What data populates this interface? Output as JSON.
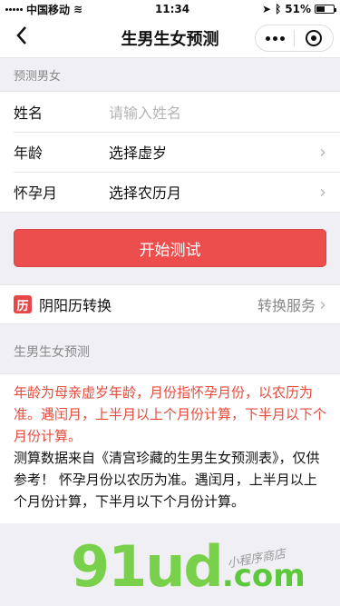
{
  "status_bar": {
    "carrier": "中国移动",
    "time": "11:34",
    "battery": "51%",
    "battery_level": 0.51
  },
  "nav": {
    "title": "生男生女预测",
    "back_icon": "chevron-left-icon",
    "more_icon": "more-dots-icon",
    "close_icon": "target-circle-icon"
  },
  "form": {
    "section_title": "预测男女",
    "rows": [
      {
        "label": "姓名",
        "placeholder": "请输入姓名"
      },
      {
        "label": "年龄",
        "value": "选择虚岁"
      },
      {
        "label": "怀孕月",
        "value": "选择农历月"
      }
    ]
  },
  "start_button": "开始测试",
  "convert": {
    "logo": "历",
    "label": "阴阳历转换",
    "service": "转换服务"
  },
  "info": {
    "title": "生男生女预测",
    "note_red": "年龄为母亲虚岁年龄，月份指怀孕月份，以农历为准。遇闰月，上半月以上个月份计算，下半月以下个月份计算。",
    "note_black": "测算数据来自《清宫珍藏的生男生女预测表》，仅供参考！ 怀孕月份以农历为准。遇闰月，上半月以上个月份计算，下半月以下个月份计算。"
  },
  "watermark": {
    "brand": "91ud",
    "domain": ".com",
    "sub": "小程序商店"
  },
  "colors": {
    "accent": "#ec4e4e",
    "note_red": "#e44b3c",
    "watermark_green": "#79d14b"
  }
}
